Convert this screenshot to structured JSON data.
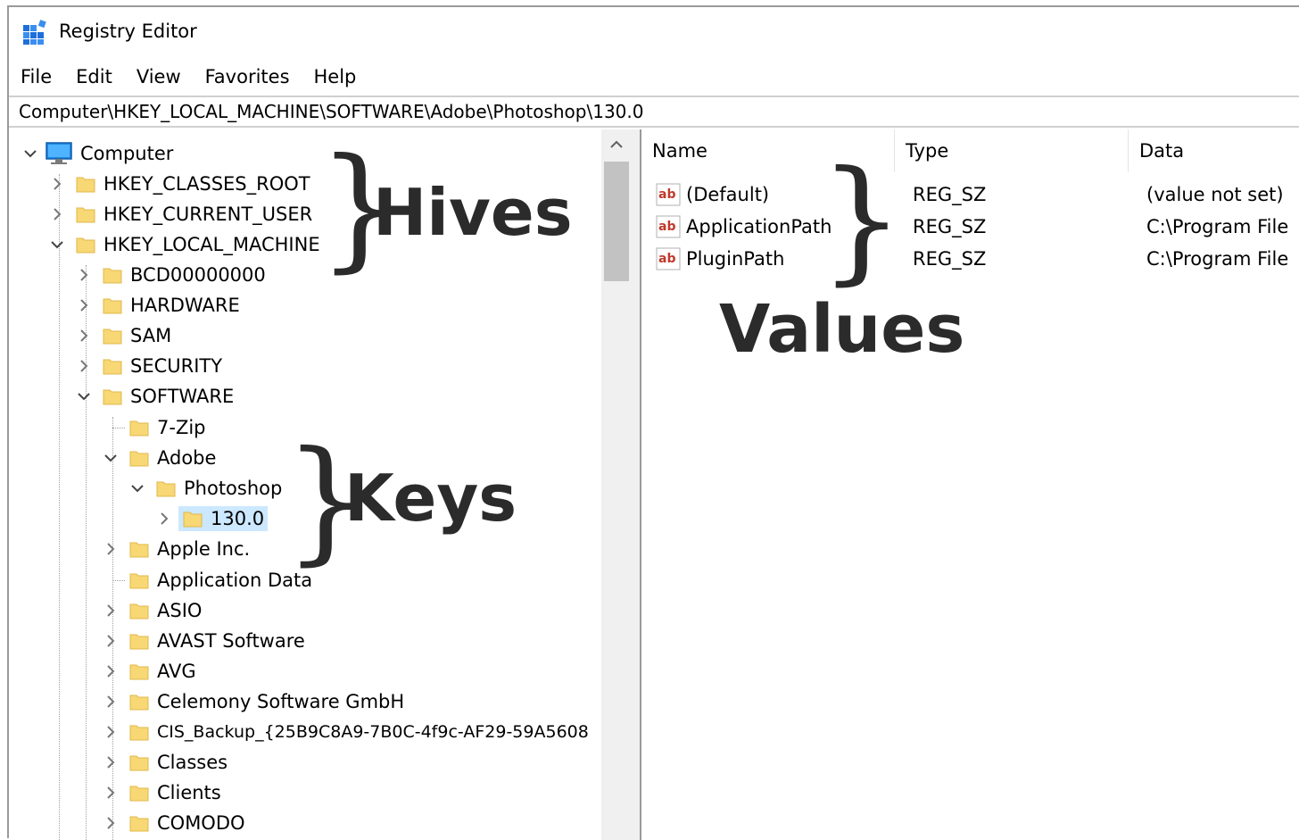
{
  "window": {
    "title": "Registry Editor",
    "icon": "registry-editor-icon"
  },
  "menu": [
    "File",
    "Edit",
    "View",
    "Favorites",
    "Help"
  ],
  "address": "Computer\\HKEY_LOCAL_MACHINE\\SOFTWARE\\Adobe\\Photoshop\\130.0",
  "tree": {
    "root": "Computer",
    "hives": [
      "HKEY_CLASSES_ROOT",
      "HKEY_CURRENT_USER",
      "HKEY_LOCAL_MACHINE"
    ],
    "hklm_children": [
      "BCD00000000",
      "HARDWARE",
      "SAM",
      "SECURITY",
      "SOFTWARE"
    ],
    "software_children": [
      "7-Zip",
      "Adobe",
      "Apple Inc.",
      "Application Data",
      "ASIO",
      "AVAST Software",
      "AVG",
      "Celemony Software GmbH",
      "CIS_Backup_{25B9C8A9-7B0C-4f9c-AF29-59A5608",
      "Classes",
      "Clients",
      "COMODO"
    ],
    "adobe_child": "Photoshop",
    "photoshop_child": "130.0",
    "selected": "130.0"
  },
  "values": {
    "columns": [
      "Name",
      "Type",
      "Data"
    ],
    "rows": [
      {
        "name": "(Default)",
        "type": "REG_SZ",
        "data": "(value not set)"
      },
      {
        "name": "ApplicationPath",
        "type": "REG_SZ",
        "data": "C:\\Program File"
      },
      {
        "name": "PluginPath",
        "type": "REG_SZ",
        "data": "C:\\Program File"
      }
    ]
  },
  "annotations": {
    "hives": "Hives",
    "values": "Values",
    "keys": "Keys",
    "brace": "}"
  },
  "colors": {
    "folder": "#f8d775",
    "selection": "#cce8ff",
    "annotation": "#2b2b2b",
    "computer_icon": "#1e88e5"
  }
}
